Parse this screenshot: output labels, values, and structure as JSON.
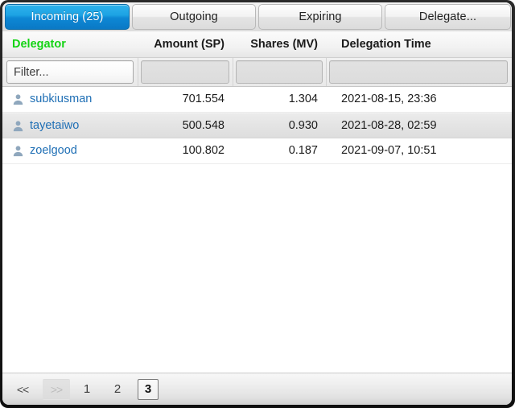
{
  "window": {
    "accent_color": "#0d87d4",
    "sorted_header_color": "#14d414",
    "link_color": "#1f6fb5"
  },
  "tabs": [
    {
      "label": "Incoming (25)",
      "active": true
    },
    {
      "label": "Outgoing",
      "active": false
    },
    {
      "label": "Expiring",
      "active": false
    },
    {
      "label": "Delegate...",
      "active": false
    }
  ],
  "table": {
    "columns": [
      {
        "label": "Delegator",
        "align": "left",
        "sorted": true
      },
      {
        "label": "Amount (SP)",
        "align": "right",
        "sorted": false
      },
      {
        "label": "Shares (MV)",
        "align": "right",
        "sorted": false
      },
      {
        "label": "Delegation Time",
        "align": "left",
        "sorted": false
      }
    ],
    "filter": {
      "placeholder": "Filter...",
      "value": ""
    },
    "rows": [
      {
        "delegator": "subkiusman",
        "amount": "701.554",
        "shares": "1.304",
        "time": "2021-08-15, 23:36",
        "highlighted": false
      },
      {
        "delegator": "tayetaiwo",
        "amount": "500.548",
        "shares": "0.930",
        "time": "2021-08-28, 02:59",
        "highlighted": true
      },
      {
        "delegator": "zoelgood",
        "amount": "100.802",
        "shares": "0.187",
        "time": "2021-09-07, 10:51",
        "highlighted": false
      }
    ]
  },
  "pagination": {
    "first_label": "<<",
    "next_label": ">>",
    "pages": [
      "1",
      "2",
      "3"
    ],
    "current_page": "3"
  }
}
